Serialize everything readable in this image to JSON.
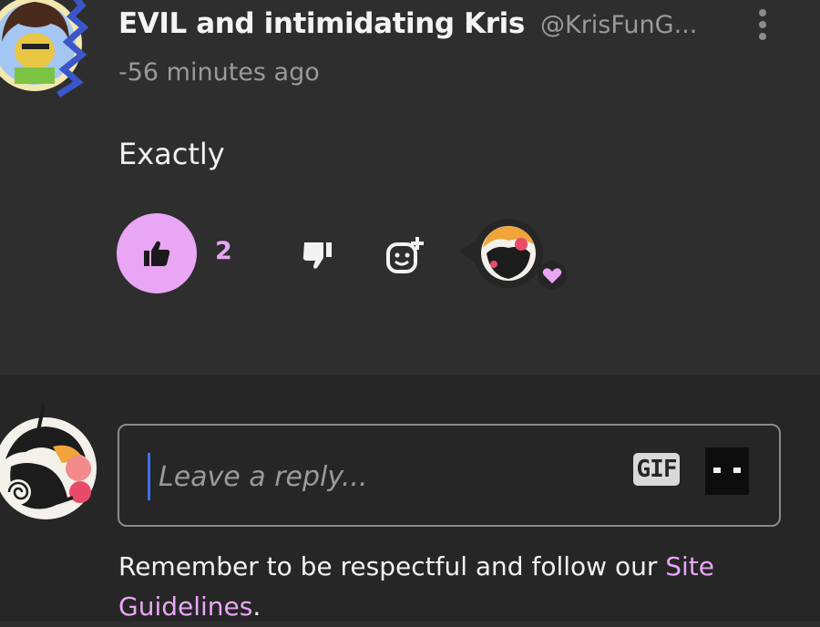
{
  "comment": {
    "author_name": "EVIL and intimidating Kris",
    "author_handle": "@KrisFunG...",
    "timestamp": "-56 minutes ago",
    "body": "Exactly",
    "like_count": "2"
  },
  "reply": {
    "placeholder": "Leave a reply...",
    "gif_label": "GIF"
  },
  "guidelines": {
    "prefix": "Remember to be respectful and follow our ",
    "link": "Site Guidelines",
    "suffix": "."
  },
  "colors": {
    "accent": "#e9a6f5",
    "background": "#2e2e2e",
    "input_background": "#262626",
    "caret": "#3d6df2"
  },
  "icons": [
    "thumbs-up-icon",
    "thumbs-down-icon",
    "add-reaction-icon",
    "heart-icon",
    "more-vertical-icon",
    "ninja-icon"
  ]
}
